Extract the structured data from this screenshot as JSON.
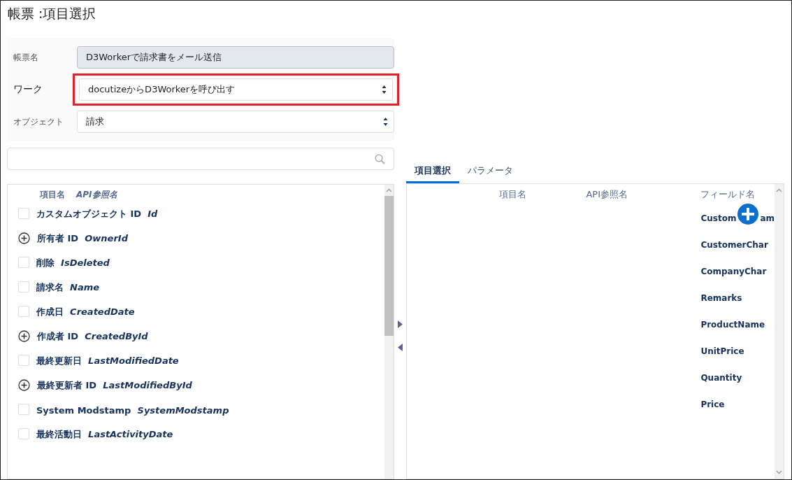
{
  "title": "帳票 :項目選択",
  "form": [
    {
      "label": "帳票名",
      "kind": "readonly",
      "value": "D3Workerで請求書をメール送信",
      "highlighted": false
    },
    {
      "label": "ワーク",
      "kind": "select",
      "value": "docutizeからD3Workerを呼び出す",
      "highlighted": true
    },
    {
      "label": "オブジェクト",
      "kind": "select",
      "value": "請求",
      "highlighted": false
    }
  ],
  "left_list": {
    "columns": [
      "項目名",
      "API参照名"
    ],
    "rows": [
      {
        "kind": "checkbox",
        "checked": false,
        "label": "カスタムオブジェクト ID",
        "api": "Id"
      },
      {
        "kind": "expand",
        "label": "所有者 ID",
        "api": "OwnerId"
      },
      {
        "kind": "checkbox",
        "checked": false,
        "label": "削除",
        "api": "IsDeleted"
      },
      {
        "kind": "checkbox",
        "checked": false,
        "label": "請求名",
        "api": "Name"
      },
      {
        "kind": "checkbox",
        "checked": false,
        "label": "作成日",
        "api": "CreatedDate"
      },
      {
        "kind": "expand",
        "label": "作成者 ID",
        "api": "CreatedById"
      },
      {
        "kind": "checkbox",
        "checked": false,
        "label": "最終更新日",
        "api": "LastModifiedDate"
      },
      {
        "kind": "expand",
        "label": "最終更新者 ID",
        "api": "LastModifiedById"
      },
      {
        "kind": "checkbox",
        "checked": false,
        "label": "System Modstamp",
        "api": "SystemModstamp"
      },
      {
        "kind": "checkbox",
        "checked": false,
        "label": "最終活動日",
        "api": "LastActivityDate"
      }
    ]
  },
  "tabs": [
    {
      "label": "項目選択",
      "selected": true
    },
    {
      "label": "パラメータ",
      "selected": false
    }
  ],
  "right_table": {
    "columns": [
      "項目名",
      "API参照名",
      "フィールド名"
    ],
    "rows": [
      [
        "Custom",
        "am"
      ],
      [
        "CustomerChar"
      ],
      [
        "CompanyChar"
      ],
      [
        "Remarks"
      ],
      [
        "ProductName"
      ],
      [
        "UnitPrice"
      ],
      [
        "Quantity"
      ],
      [
        "Price"
      ]
    ]
  }
}
